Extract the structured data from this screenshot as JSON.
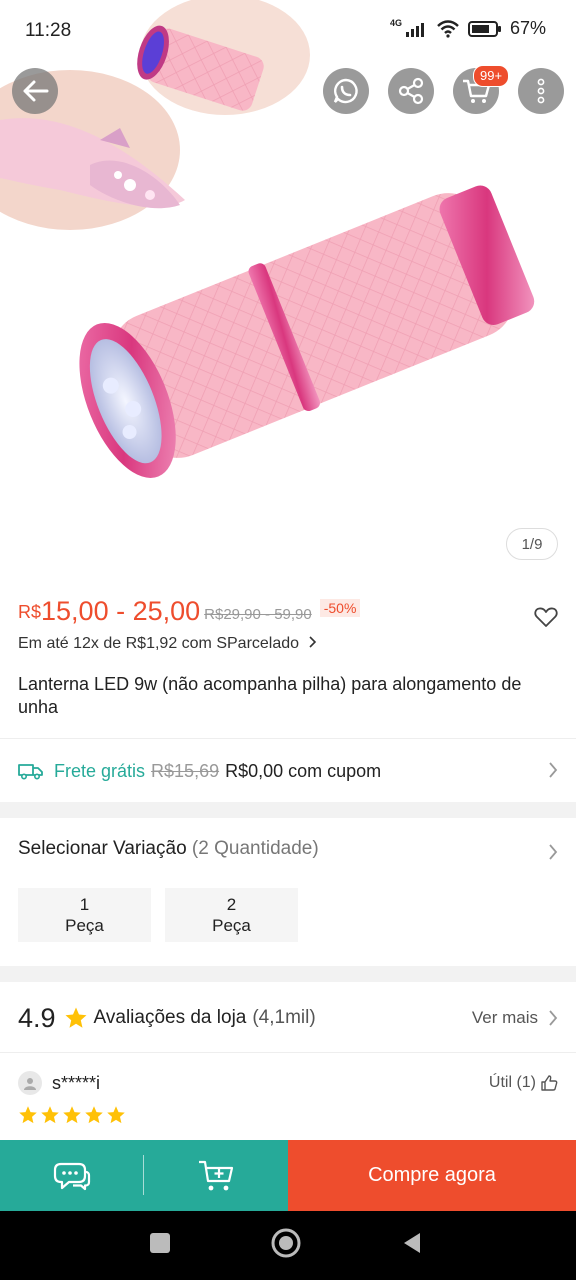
{
  "status_bar": {
    "time": "11:28",
    "network": "4G",
    "battery": "67%"
  },
  "hero": {
    "image_counter": "1/9",
    "cart_badge": "99+",
    "colors": {
      "body": "#f9b8c8",
      "ring": "#e0508f",
      "lens": "#cfd6f5"
    }
  },
  "product": {
    "price_currency": "R$",
    "price_range": "15,00 - 25,00",
    "price_old": "R$29,90 - 59,90",
    "discount": "-50%",
    "installment": "Em até 12x de R$1,92 com SParcelado",
    "title": "Lanterna LED 9w (não acompanha pilha) para alongamento de unha"
  },
  "shipping": {
    "free_label": "Frete grátis",
    "old_price": "R$15,69",
    "new_price": "R$0,00 com cupom"
  },
  "variation": {
    "label": "Selecionar Variação",
    "count": "(2 Quantidade)",
    "options": [
      {
        "line1": "1",
        "line2": "Peça"
      },
      {
        "line1": "2",
        "line2": "Peça"
      }
    ]
  },
  "ratings": {
    "value": "4.9",
    "label": "Avaliações da loja",
    "count": "(4,1mil)",
    "see_more": "Ver mais"
  },
  "review": {
    "reviewer": "s*****i",
    "useful": "Útil (1)",
    "stars": 5
  },
  "actions": {
    "buy_now": "Compre agora"
  },
  "colors": {
    "accent": "#ee4d2d",
    "teal": "#26aa99",
    "star": "#ffc107"
  }
}
